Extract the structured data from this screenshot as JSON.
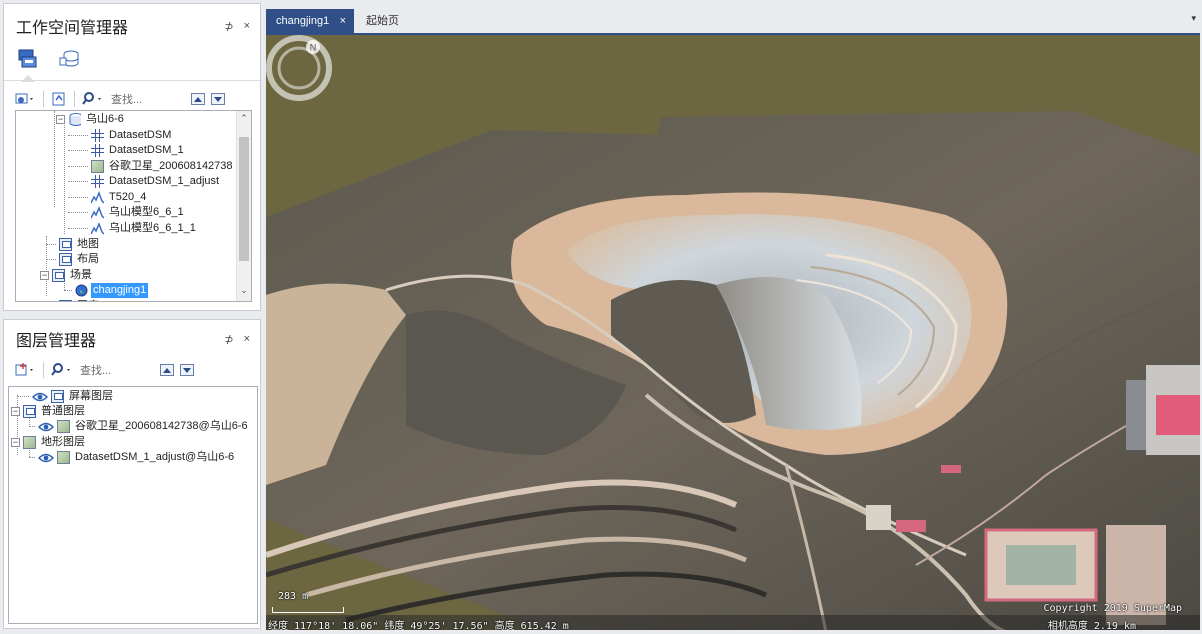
{
  "workspace_panel": {
    "title": "工作空间管理器",
    "pin": "⊅",
    "close": "×",
    "search_placeholder": "查找...",
    "tree": [
      {
        "label": "乌山6-6",
        "icon": "datasource-icon"
      },
      {
        "label": "DatasetDSM",
        "icon": "grid-icon"
      },
      {
        "label": "DatasetDSM_1",
        "icon": "grid-icon"
      },
      {
        "label": "谷歌卫星_200608142738",
        "icon": "image-icon"
      },
      {
        "label": "DatasetDSM_1_adjust",
        "icon": "grid-icon"
      },
      {
        "label": "T520_4",
        "icon": "tin-icon"
      },
      {
        "label": "乌山模型6_6_1",
        "icon": "tin-icon"
      },
      {
        "label": "乌山模型6_6_1_1",
        "icon": "tin-icon"
      },
      {
        "label": "地图",
        "icon": "map-icon"
      },
      {
        "label": "布局",
        "icon": "layout-icon"
      },
      {
        "label": "场景",
        "icon": "scene-icon"
      },
      {
        "label": "changjing1",
        "icon": "globe-icon",
        "selected": true
      },
      {
        "label": "图表",
        "icon": "chart-icon"
      }
    ]
  },
  "layer_panel": {
    "title": "图层管理器",
    "pin": "⊅",
    "close": "×",
    "search_placeholder": "查找...",
    "tree": [
      {
        "label": "屏幕图层"
      },
      {
        "label": "普通图层"
      },
      {
        "label": "谷歌卫星_200608142738@乌山6-6"
      },
      {
        "label": "地形图层"
      },
      {
        "label": "DatasetDSM_1_adjust@乌山6-6"
      }
    ]
  },
  "tabs": {
    "active": "changjing1",
    "active_close": "×",
    "start": "起始页",
    "menu": "▾"
  },
  "scene": {
    "scale_label": "283 m",
    "coords": "经度 117°18' 18.06\"  纬度 49°25' 17.56\"  高度 615.42 m",
    "copyright": "Copyright 2019 SuperMap",
    "camera_height": "相机高度 2.19 km",
    "compass_letter": "N"
  }
}
